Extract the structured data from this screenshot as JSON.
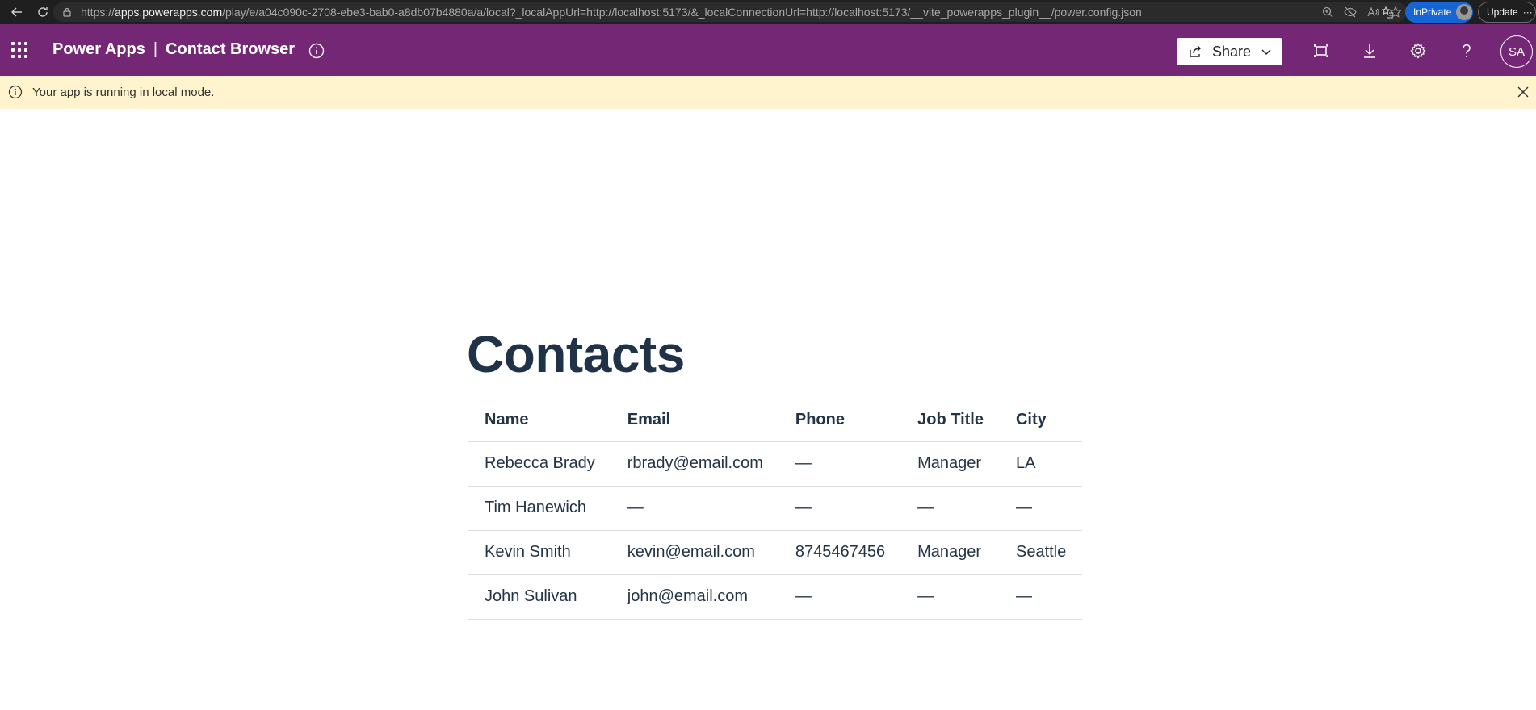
{
  "browser": {
    "url_prefix": "https://",
    "url_host": "apps.powerapps.com",
    "url_path": "/play/e/a04c090c-2708-ebe3-bab0-a8db07b4880a/a/local?_localAppUrl=http://localhost:5173/&_localConnectionUrl=http://localhost:5173/__vite_powerapps_plugin__/power.config.json",
    "inprivate_label": "InPrivate",
    "update_label": "Update"
  },
  "header": {
    "product": "Power Apps",
    "separator": "|",
    "app_name": "Contact Browser",
    "share_label": "Share",
    "avatar_initials": "SA",
    "bg_color": "#742774"
  },
  "banner": {
    "message": "Your app is running in local mode."
  },
  "main": {
    "title": "Contacts",
    "columns": [
      "Name",
      "Email",
      "Phone",
      "Job Title",
      "City"
    ],
    "rows": [
      [
        "Rebecca Brady",
        "rbrady@email.com",
        "—",
        "Manager",
        "LA"
      ],
      [
        "Tim Hanewich",
        "—",
        "—",
        "—",
        "—"
      ],
      [
        "Kevin Smith",
        "kevin@email.com",
        "8745467456",
        "Manager",
        "Seattle"
      ],
      [
        "John Sulivan",
        "john@email.com",
        "—",
        "—",
        "—"
      ]
    ]
  },
  "icons": {
    "back": "back-arrow-icon",
    "refresh": "refresh-icon",
    "lock": "lock-icon",
    "waffle": "waffle-icon",
    "info": "info-icon",
    "share": "share-icon",
    "fit": "fit-to-screen-icon",
    "download": "download-icon",
    "settings": "gear-icon",
    "help": "help-icon",
    "close": "close-icon"
  }
}
